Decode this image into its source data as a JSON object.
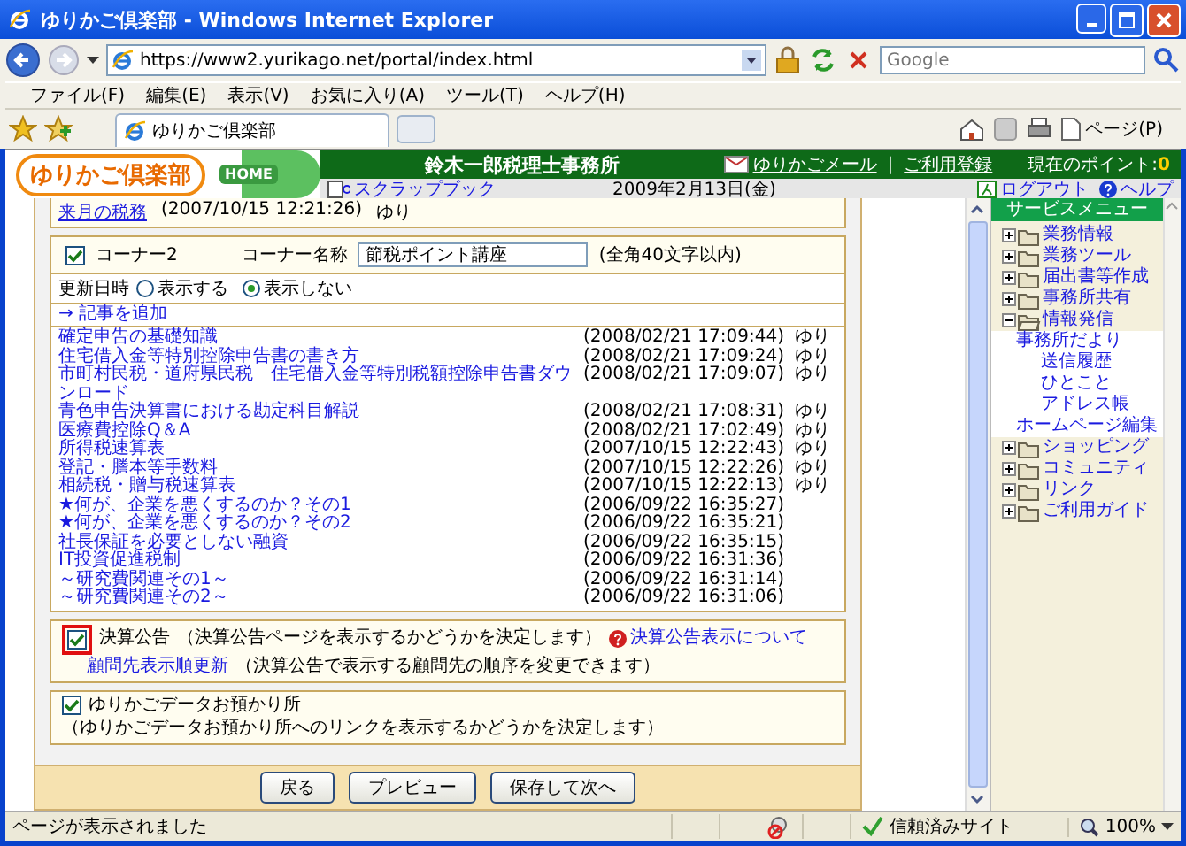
{
  "window": {
    "title": "ゆりかご倶楽部 - Windows Internet Explorer"
  },
  "address_bar": {
    "url": "https://www2.yurikago.net/portal/index.html"
  },
  "search": {
    "placeholder": "Google"
  },
  "menu_bar": [
    "ファイル(F)",
    "編集(E)",
    "表示(V)",
    "お気に入り(A)",
    "ツール(T)",
    "ヘルプ(H)"
  ],
  "tabs": [
    {
      "label": "ゆりかご倶楽部",
      "selected": true
    }
  ],
  "command_bar": {
    "page_menu": "ページ(P)"
  },
  "site_header": {
    "logo": "ゆりかご倶楽部",
    "home": "HOME",
    "office": "鈴木一郎税理士事務所",
    "mail_link": "ゆりかごメール",
    "separator": "|",
    "register_link": "ご利用登録",
    "points_label": "現在のポイント:",
    "points": "0",
    "scrapbook": "スクラップブック",
    "date": "2009年2月13日(金)",
    "logout": "ログアウト",
    "help": "ヘルプ"
  },
  "previous_article": {
    "title": "来月の税務",
    "meta": "(2007/10/15 12:21:26)",
    "author": "ゆり"
  },
  "corner": {
    "label": "コーナー2",
    "checked": true,
    "name_label": "コーナー名称",
    "name_value": "節税ポイント講座",
    "name_hint": "(全角40文字以内)",
    "updated_label": "更新日時",
    "radios": [
      {
        "label": "表示する",
        "selected": false
      },
      {
        "label": "表示しない",
        "selected": true
      }
    ],
    "add_link": "→ 記事を追加",
    "articles": [
      {
        "title": "確定申告の基礎知識",
        "meta": "(2008/02/21 17:09:44)",
        "author": "ゆり"
      },
      {
        "title": "住宅借入金等特別控除申告書の書き方",
        "meta": "(2008/02/21 17:09:24)",
        "author": "ゆり"
      },
      {
        "title": "市町村民税・道府県民税　住宅借入金等特別税額控除申告書ダウンロード",
        "meta": "(2008/02/21 17:09:07)",
        "author": "ゆり"
      },
      {
        "title": "青色申告決算書における勘定科目解説",
        "meta": "(2008/02/21 17:08:31)",
        "author": "ゆり"
      },
      {
        "title": "医療費控除Q＆A",
        "meta": "(2008/02/21 17:02:49)",
        "author": "ゆり"
      },
      {
        "title": "所得税速算表",
        "meta": "(2007/10/15 12:22:43)",
        "author": "ゆり"
      },
      {
        "title": "登記・謄本等手数料",
        "meta": "(2007/10/15 12:22:26)",
        "author": "ゆり"
      },
      {
        "title": "相続税・贈与税速算表",
        "meta": "(2007/10/15 12:22:13)",
        "author": "ゆり"
      },
      {
        "title": "★何が、企業を悪くするのか？その1",
        "meta": "(2006/09/22 16:35:27)"
      },
      {
        "title": "★何が、企業を悪くするのか？その2",
        "meta": "(2006/09/22 16:35:21)"
      },
      {
        "title": "社長保証を必要としない融資",
        "meta": "(2006/09/22 16:35:15)"
      },
      {
        "title": "IT投資促進税制",
        "meta": "(2006/09/22 16:31:36)"
      },
      {
        "title": "～研究費関連その1～",
        "meta": "(2006/09/22 16:31:14)"
      },
      {
        "title": "～研究費関連その2～",
        "meta": "(2006/09/22 16:31:06)"
      }
    ]
  },
  "settlement": {
    "label": "決算公告",
    "checked": true,
    "highlighted": true,
    "description": "（決算公告ページを表示するかどうかを決定します）",
    "help_link": "決算公告表示について",
    "order_link": "顧問先表示順更新",
    "order_description": "（決算公告で表示する顧問先の順序を変更できます）"
  },
  "data_storage": {
    "label": "ゆりかごデータお預かり所",
    "checked": true,
    "description": "（ゆりかごデータお預かり所へのリンクを表示するかどうかを決定します）"
  },
  "buttons": [
    "戻る",
    "プレビュー",
    "保存して次へ"
  ],
  "sidebar": {
    "title": "サービスメニュー",
    "items": [
      {
        "label": "業務情報",
        "expanded": false
      },
      {
        "label": "業務ツール",
        "expanded": false
      },
      {
        "label": "届出書等作成",
        "expanded": false
      },
      {
        "label": "事務所共有",
        "expanded": false
      },
      {
        "label": "情報発信",
        "expanded": true,
        "children": [
          {
            "label": "事務所だより",
            "children": [
              {
                "label": "送信履歴"
              },
              {
                "label": "ひとこと"
              },
              {
                "label": "アドレス帳"
              }
            ]
          },
          {
            "label": "ホームページ編集"
          }
        ]
      },
      {
        "label": "ショッピング",
        "expanded": false
      },
      {
        "label": "コミュニティ",
        "expanded": false
      },
      {
        "label": "リンク",
        "expanded": false
      },
      {
        "label": "ご利用ガイド",
        "expanded": false
      }
    ]
  },
  "status_bar": {
    "text": "ページが表示されました",
    "zone": "信頼済みサイト",
    "zoom": "100%"
  }
}
